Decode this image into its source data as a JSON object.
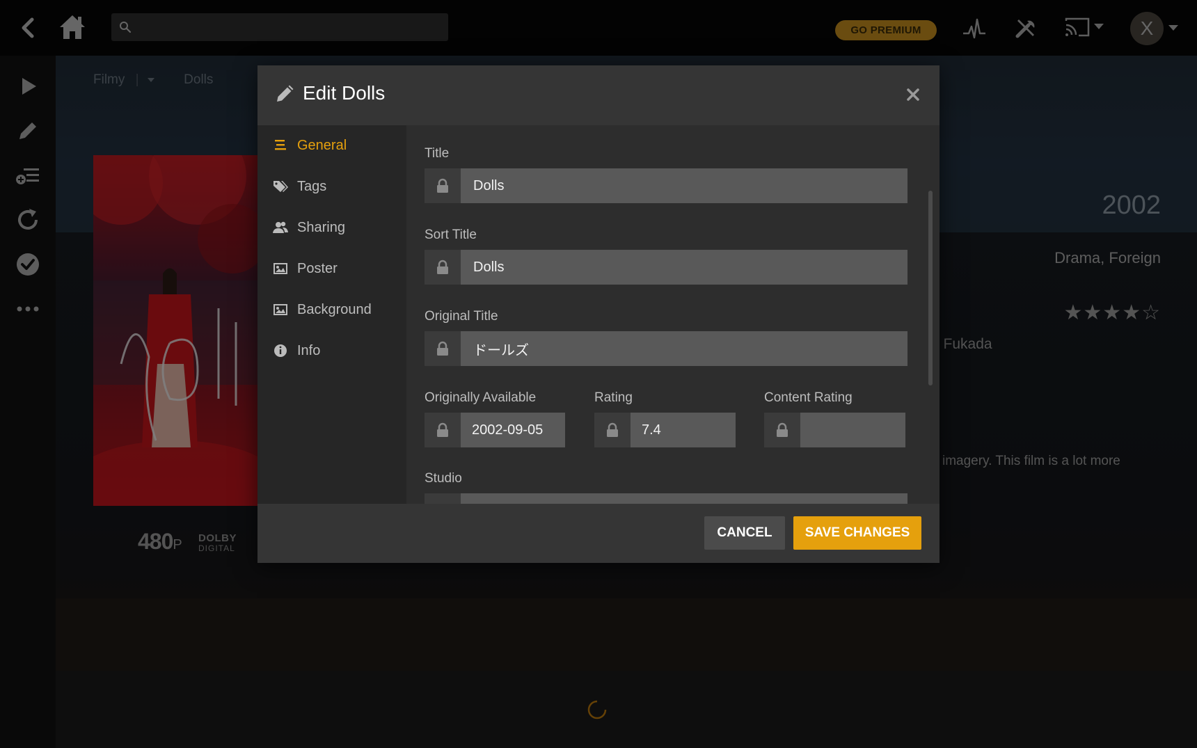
{
  "topbar": {
    "search_placeholder": "",
    "go_premium_label": "GO PREMIUM",
    "avatar_initial": "X",
    "icons": [
      "back-icon",
      "home-icon",
      "search-icon",
      "activity-icon",
      "tools-icon",
      "cast-icon",
      "chevron-down-icon"
    ]
  },
  "sidebar": {
    "icons": [
      "play-icon",
      "pencil-icon",
      "add-to-playlist-icon",
      "refresh-icon",
      "check-circle-icon",
      "more-icon"
    ]
  },
  "background": {
    "breadcrumb": {
      "library": "Filmy",
      "separator": "|",
      "current": "Dolls"
    },
    "year": "2002",
    "genres": "Drama, Foreign",
    "stars": "★★★★☆",
    "director_fragment": "o Fukada",
    "summary_fragment": "imagery. This film is a lot more",
    "resolution": "480",
    "resolution_suffix": "P",
    "audio_line1": "DOLBY",
    "audio_line2": "DIGITAL"
  },
  "modal": {
    "title": "Edit Dolls",
    "nav": [
      {
        "label": "General",
        "icon": "lines-icon",
        "active": true
      },
      {
        "label": "Tags",
        "icon": "tags-icon",
        "active": false
      },
      {
        "label": "Sharing",
        "icon": "users-icon",
        "active": false
      },
      {
        "label": "Poster",
        "icon": "image-icon",
        "active": false
      },
      {
        "label": "Background",
        "icon": "image-icon",
        "active": false
      },
      {
        "label": "Info",
        "icon": "info-icon",
        "active": false
      }
    ],
    "fields": {
      "title": {
        "label": "Title",
        "value": "Dolls"
      },
      "sort_title": {
        "label": "Sort Title",
        "value": "Dolls"
      },
      "original_title": {
        "label": "Original Title",
        "value": "ドールズ"
      },
      "originally_available": {
        "label": "Originally Available",
        "value": "2002-09-05"
      },
      "rating": {
        "label": "Rating",
        "value": "7.4"
      },
      "content_rating": {
        "label": "Content Rating",
        "value": ""
      },
      "studio": {
        "label": "Studio",
        "value": ""
      }
    },
    "buttons": {
      "cancel": "CANCEL",
      "save": "SAVE CHANGES"
    }
  },
  "colors": {
    "accent": "#e5a00d",
    "premium": "#c18b1e",
    "modal_bg": "#2a2a2a",
    "field_bg": "#595959"
  }
}
